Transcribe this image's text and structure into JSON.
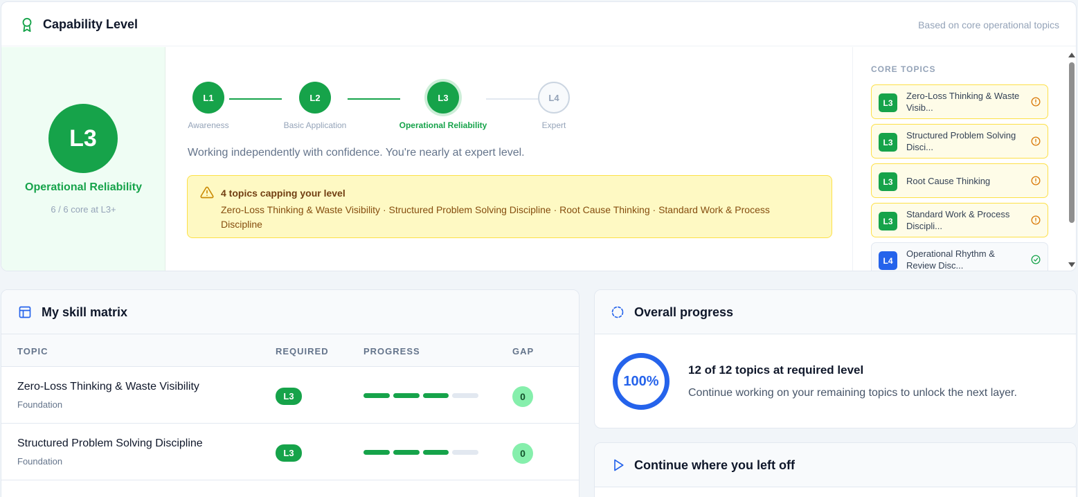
{
  "capability": {
    "title": "Capability Level",
    "subtitle": "Based on core operational topics",
    "current_level": "L3",
    "current_name": "Operational Reliability",
    "core_count": "6 / 6 core at L3+",
    "steps": [
      {
        "code": "L1",
        "label": "Awareness"
      },
      {
        "code": "L2",
        "label": "Basic Application"
      },
      {
        "code": "L3",
        "label": "Operational Reliability"
      },
      {
        "code": "L4",
        "label": "Expert"
      }
    ],
    "description": "Working independently with confidence. You're nearly at expert level.",
    "warning": {
      "title": "4 topics capping your level",
      "text": "Zero-Loss Thinking & Waste Visibility · Structured Problem Solving Discipline · Root Cause Thinking · Standard Work & Process Discipline"
    },
    "core_topics_label": "CORE TOPICS",
    "core_topics": [
      {
        "level": "L3",
        "name": "Zero-Loss Thinking & Waste Visib...",
        "status": "warning"
      },
      {
        "level": "L3",
        "name": "Structured Problem Solving Disci...",
        "status": "warning"
      },
      {
        "level": "L3",
        "name": "Root Cause Thinking",
        "status": "warning"
      },
      {
        "level": "L3",
        "name": "Standard Work & Process Discipli...",
        "status": "warning"
      },
      {
        "level": "L4",
        "name": "Operational Rhythm & Review Disc...",
        "status": "ok"
      }
    ]
  },
  "matrix": {
    "title": "My skill matrix",
    "columns": {
      "topic": "TOPIC",
      "required": "REQUIRED",
      "progress": "PROGRESS",
      "gap": "GAP"
    },
    "rows": [
      {
        "name": "Zero-Loss Thinking & Waste Visibility",
        "category": "Foundation",
        "required": "L3",
        "progress": 3,
        "gap": "0"
      },
      {
        "name": "Structured Problem Solving Discipline",
        "category": "Foundation",
        "required": "L3",
        "progress": 3,
        "gap": "0"
      }
    ]
  },
  "overall": {
    "title": "Overall progress",
    "percent": "100%",
    "summary": "12 of 12 topics at required level",
    "detail": "Continue working on your remaining topics to unlock the next layer."
  },
  "continue": {
    "title": "Continue where you left off"
  },
  "colors": {
    "green": "#16a34a",
    "blue": "#2563eb",
    "warning_bg": "#fef9c3",
    "warning_border": "#fde047"
  }
}
